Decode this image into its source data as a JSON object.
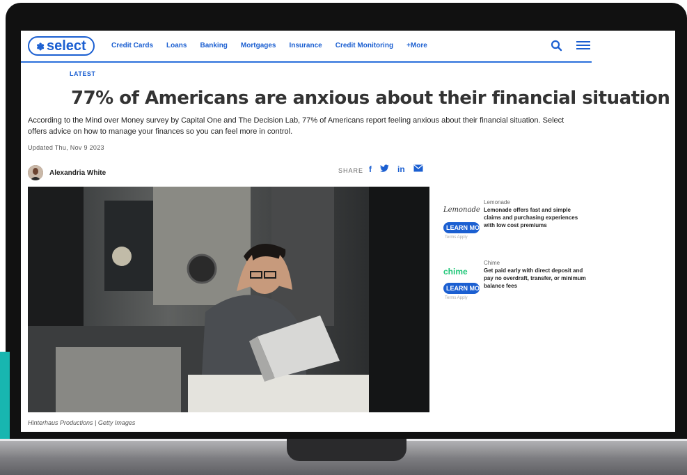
{
  "nav": {
    "logo_text": "select",
    "links": [
      "Credit Cards",
      "Loans",
      "Banking",
      "Mortgages",
      "Insurance",
      "Credit Monitoring",
      "+More"
    ]
  },
  "article": {
    "kicker": "LATEST",
    "headline": "77% of Americans are anxious about their financial situation",
    "dek": "According to the Mind over Money survey by Capital One and The Decision Lab, 77% of Americans report feeling anxious about their financial situation. Select offers advice on how to manage your finances so you can feel more in control.",
    "updated": "Updated Thu, Nov 9 2023",
    "author": "Alexandria White",
    "share_label": "SHARE",
    "share_icons": [
      "f",
      "✓",
      "in",
      "✉"
    ],
    "photo_caption": "Hinterhaus Productions | Getty Images"
  },
  "ads": [
    {
      "logo": "Lemonade",
      "button": "LEARN MORE",
      "terms": "Terms Apply",
      "brand": "Lemonade",
      "desc": "Lemonade offers fast and simple claims and purchasing experiences with low cost premiums"
    },
    {
      "logo": "chime",
      "button": "LEARN MORE",
      "terms": "Terms Apply",
      "brand": "Chime",
      "desc": "Get paid early with direct deposit and pay no overdraft, transfer, or minimum balance fees"
    }
  ],
  "colors": {
    "brand_blue": "#1b5fd1",
    "chime_green": "#1ec677",
    "teal_accent": "#18b6b0"
  }
}
